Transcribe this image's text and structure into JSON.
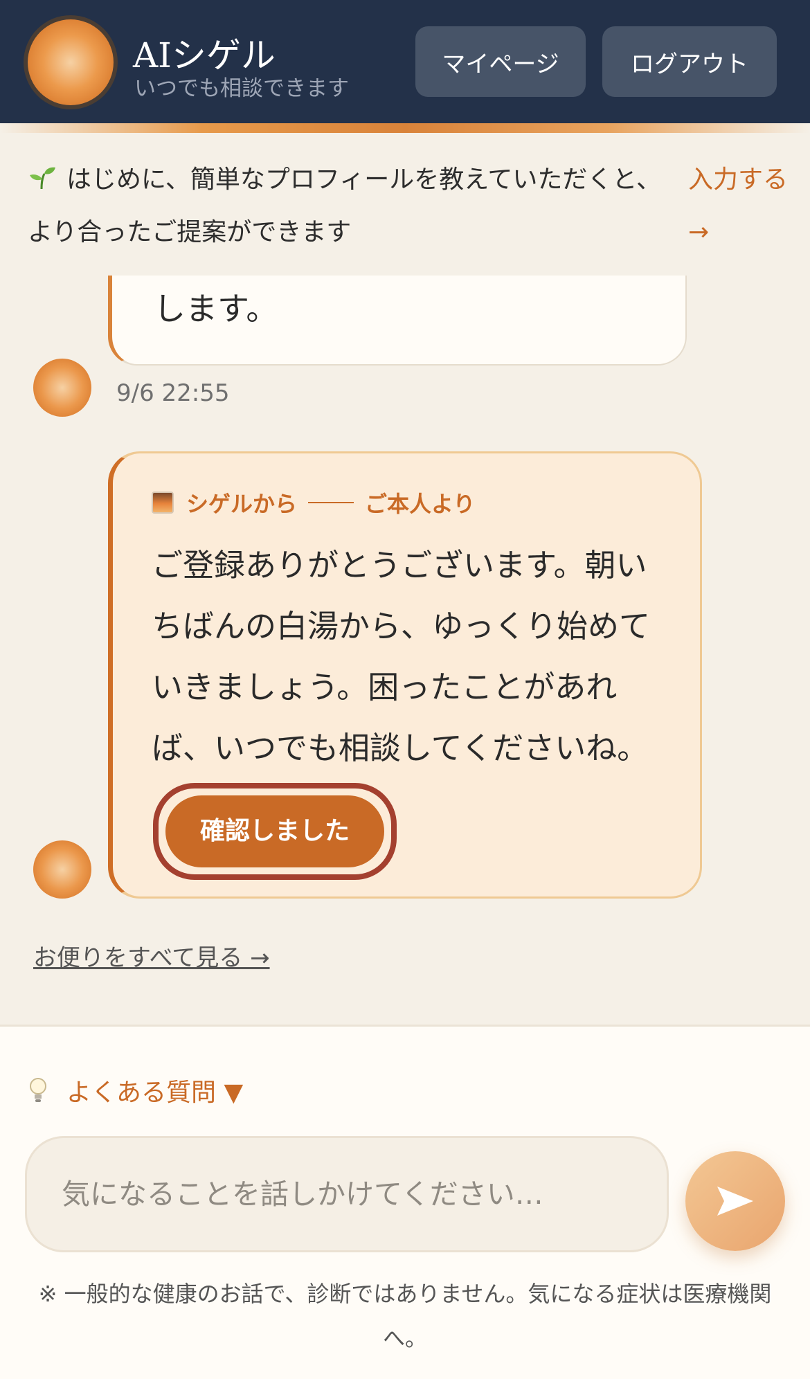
{
  "header": {
    "app_title": "AIシゲル",
    "app_subtitle": "いつでも相談できます",
    "mypage_label": "マイページ",
    "logout_label": "ログアウト"
  },
  "profile_prompt": {
    "text": "はじめに、簡単なプロフィールを教えていただくと、より合ったご提案ができます",
    "link_label": "入力する →",
    "icon": "sprout-icon"
  },
  "messages": {
    "prev_message_tail": "します。",
    "prev_timestamp": "9/6 22:55",
    "card": {
      "from_label": "シゲルから",
      "source_label": "ご本人より",
      "icon": "sunrise-icon",
      "body": "ご登録ありがとうございます。朝いちばんの白湯から、ゆっくり始めていきましょう。困ったことがあれば、いつでも相談してくださいね。",
      "confirm_label": "確認しました"
    },
    "all_letters_link": "お便りをすべて見る →"
  },
  "composer": {
    "faq_label": "よくある質問 ▼",
    "input_placeholder": "気になることを話しかけてください…",
    "input_value": "",
    "disclaimer": "※ 一般的な健康のお話で、診断ではありません。気になる症状は医療機関へ。"
  },
  "colors": {
    "header_bg": "#233149",
    "accent": "#c96a26",
    "page_bg": "#f5f0e7",
    "card_bg": "#fcecd9",
    "highlight_ring": "#a4402f"
  }
}
